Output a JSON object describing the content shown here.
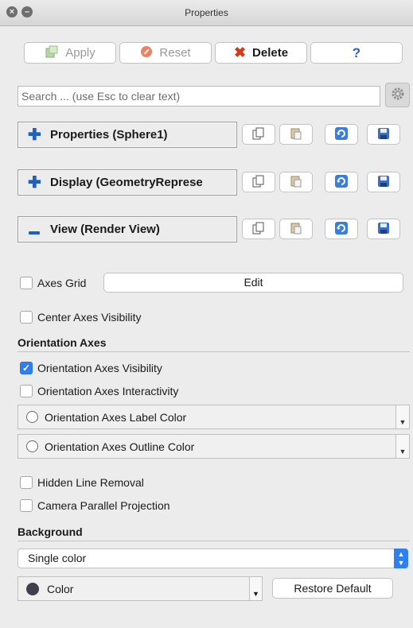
{
  "window": {
    "title": "Properties"
  },
  "toolbar": {
    "apply_label": "Apply",
    "reset_label": "Reset",
    "delete_label": "Delete",
    "help_label": "?"
  },
  "search": {
    "placeholder": "Search ... (use Esc to clear text)"
  },
  "sections": {
    "properties": "Properties (Sphere1)",
    "display": "Display (GeometryReprese",
    "view": "View (Render View)"
  },
  "view_options": {
    "axes_grid": {
      "label": "Axes Grid",
      "checked": false,
      "edit_label": "Edit"
    },
    "center_axes": {
      "label": "Center Axes Visibility",
      "checked": false
    },
    "orientation_heading": "Orientation Axes",
    "orientation_visibility": {
      "label": "Orientation Axes Visibility",
      "checked": true
    },
    "orientation_interactivity": {
      "label": "Orientation Axes Interactivity",
      "checked": false
    },
    "label_color": "Orientation Axes Label Color",
    "outline_color": "Orientation Axes Outline Color",
    "hidden_line_removal": {
      "label": "Hidden Line Removal",
      "checked": false
    },
    "camera_parallel": {
      "label": "Camera Parallel Projection",
      "checked": false
    }
  },
  "background": {
    "heading": "Background",
    "mode": "Single color",
    "color_label": "Color",
    "restore_label": "Restore Default"
  },
  "colors": {
    "accent": "#2f7ff0",
    "section_icon": "#1f5fbf",
    "delete_red": "#d43a1f",
    "reset_orange": "#e8603a",
    "apply_green": "#5aa34a",
    "help_blue": "#2a5fc4",
    "swatch": "#3f3f50"
  }
}
